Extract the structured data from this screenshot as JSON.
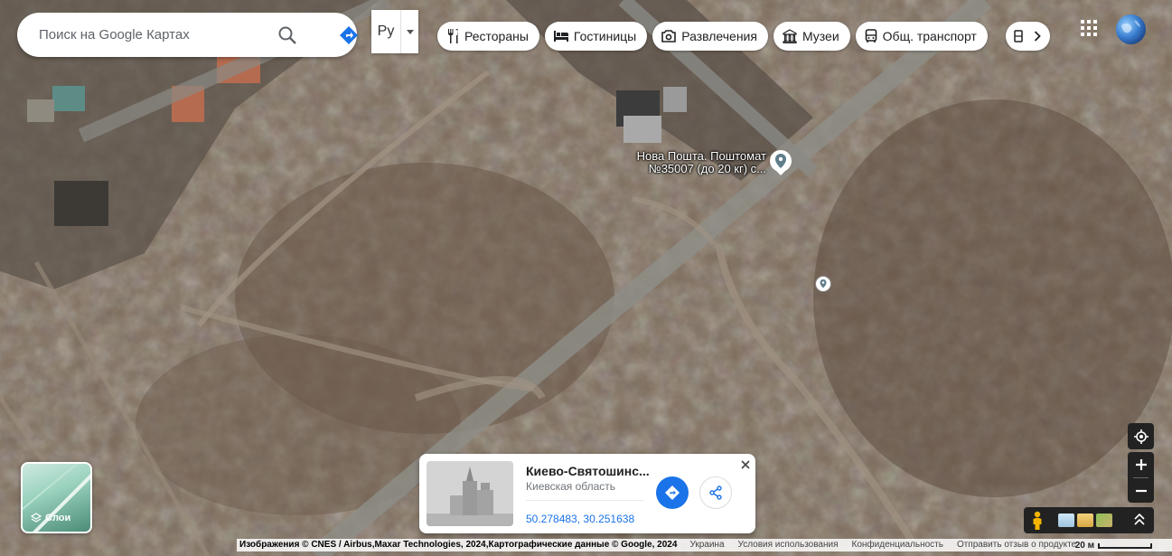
{
  "search": {
    "placeholder": "Поиск на Google Картах"
  },
  "language": {
    "label": "Ру"
  },
  "chips": [
    {
      "label": "Рестораны",
      "icon": "fork-knife-icon"
    },
    {
      "label": "Гостиницы",
      "icon": "bed-icon"
    },
    {
      "label": "Развлечения",
      "icon": "camera-icon"
    },
    {
      "label": "Музеи",
      "icon": "museum-icon"
    },
    {
      "label": "Общ. транспорт",
      "icon": "bus-icon"
    }
  ],
  "map": {
    "place_label_line1": "Нова Пошта. Поштомат",
    "place_label_line2": "№35007 (до 20 кг) с..."
  },
  "layers": {
    "label": "Слои"
  },
  "info_card": {
    "title": "Киево-Святошинс...",
    "subtitle": "Киевская область",
    "coords": "50.278483, 30.251638"
  },
  "footer": {
    "attribution": "Изображения © CNES / Airbus,Maxar Technologies, 2024,Картографические данные © Google, 2024",
    "country": "Украина",
    "terms": "Условия использования",
    "privacy": "Конфиденциальность",
    "feedback": "Отправить отзыв о продукте",
    "scale": "20 м"
  },
  "colors": {
    "accent": "#1a73e8",
    "chip_bg": "#ffffff",
    "control_bg": "#222222"
  }
}
